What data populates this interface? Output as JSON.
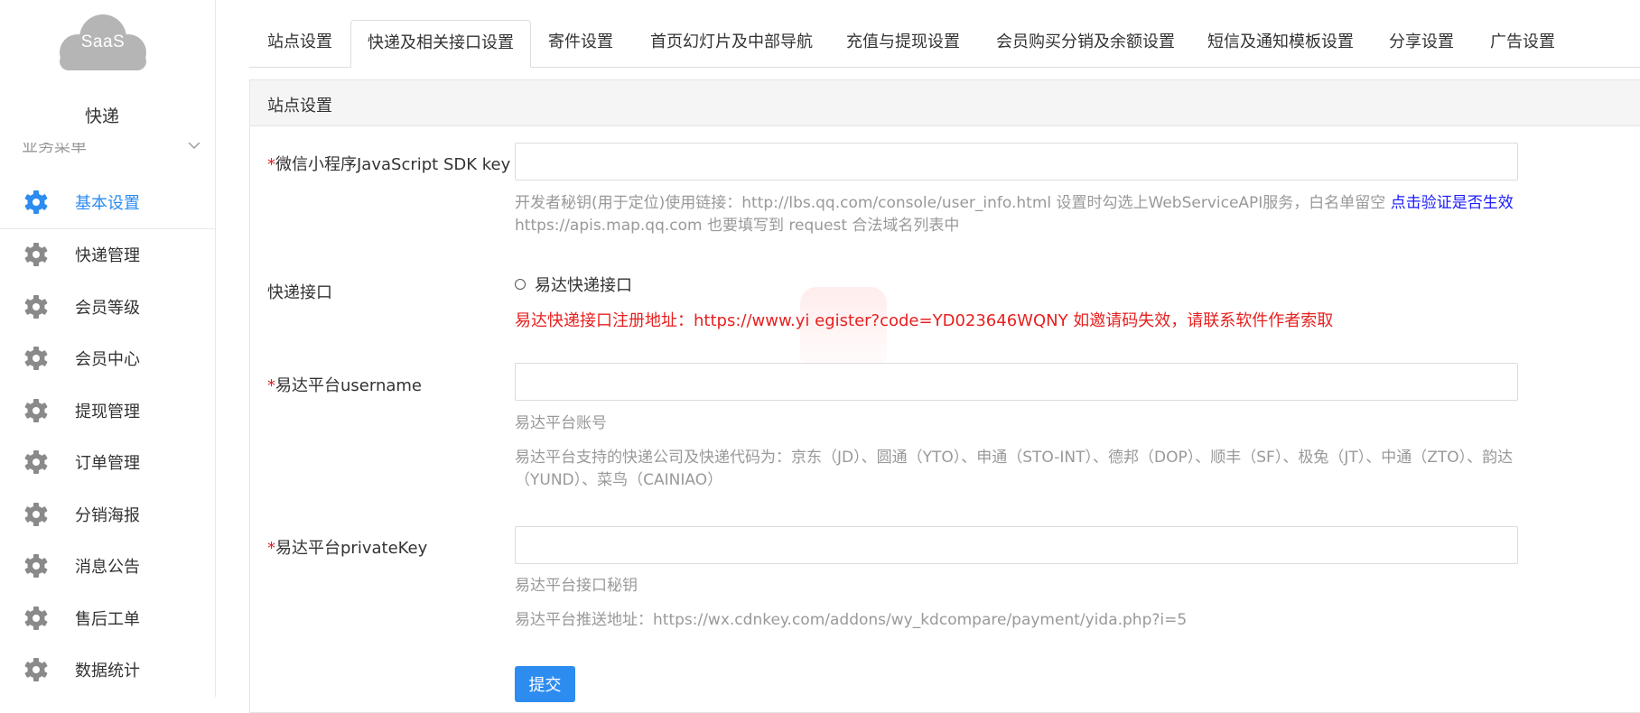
{
  "app": {
    "logo_text": "SaaS",
    "name": "快递",
    "accent_color": "#2d8cf0"
  },
  "sidebar": {
    "section_title": "业务菜单",
    "items": [
      {
        "label": "基本设置",
        "icon": "gear-icon",
        "active": true
      },
      {
        "label": "快递管理",
        "icon": "gear-icon"
      },
      {
        "label": "会员等级",
        "icon": "gear-icon"
      },
      {
        "label": "会员中心",
        "icon": "gear-icon"
      },
      {
        "label": "提现管理",
        "icon": "gear-icon"
      },
      {
        "label": "订单管理",
        "icon": "gear-icon"
      },
      {
        "label": "分销海报",
        "icon": "gear-icon"
      },
      {
        "label": "消息公告",
        "icon": "gear-icon"
      },
      {
        "label": "售后工单",
        "icon": "gear-icon"
      },
      {
        "label": "数据统计",
        "icon": "gear-icon"
      }
    ]
  },
  "tabs": [
    {
      "label": "站点设置"
    },
    {
      "label": "快递及相关接口设置",
      "active": true
    },
    {
      "label": "寄件设置"
    },
    {
      "label": "首页幻灯片及中部导航"
    },
    {
      "label": "充值与提现设置"
    },
    {
      "label": "会员购买分销及余额设置"
    },
    {
      "label": "短信及通知模板设置"
    },
    {
      "label": "分享设置"
    },
    {
      "label": "广告设置"
    }
  ],
  "panel": {
    "title": "站点设置",
    "required_mark": "*",
    "sdk_key": {
      "label": "微信小程序JavaScript SDK key",
      "value": "",
      "help_text": "开发者秘钥(用于定位)使用链接：http://lbs.qq.com/console/user_info.html 设置时勾选上WebServiceAPI服务，白名单留空",
      "help_link": "点击验证是否生效",
      "help_text_2": "https://apis.map.qq.com 也要填写到 request 合法域名列表中"
    },
    "express_api": {
      "label": "快递接口",
      "option": "易达快递接口",
      "note": "易达快递接口注册地址：https://www.yi           egister?code=YD023646WQNY 如邀请码失效，请联系软件作者索取"
    },
    "username": {
      "label": "易达平台username",
      "value": "",
      "help_1": "易达平台账号",
      "help_2": "易达平台支持的快递公司及快递代码为：京东（JD）、圆通（YTO）、申通（STO-INT）、德邦（DOP）、顺丰（SF）、极兔（JT）、中通（ZTO）、韵达（YUND）、菜鸟（CAINIAO）"
    },
    "private_key": {
      "label": "易达平台privateKey",
      "value": "",
      "help_1": "易达平台接口秘钥",
      "help_2": "易达平台推送地址：https://wx.cdnkey.com/addons/wy_kdcompare/payment/yida.php?i=5"
    },
    "submit_label": "提交"
  }
}
